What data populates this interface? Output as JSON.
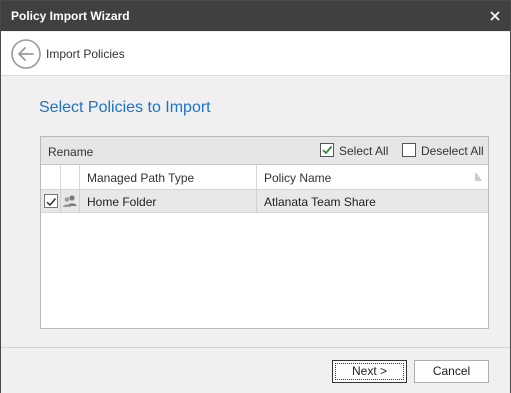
{
  "window": {
    "title": "Policy Import Wizard",
    "close_icon": "close-icon"
  },
  "nav": {
    "back_icon": "back-arrow-icon",
    "title": "Import Policies"
  },
  "heading": "Select Policies to Import",
  "grid": {
    "toolbar": {
      "rename_label": "Rename",
      "select_all_label": "Select All",
      "select_all_checked": true,
      "deselect_all_label": "Deselect All",
      "deselect_all_checked": false
    },
    "columns": [
      "Managed Path Type",
      "Policy Name"
    ],
    "rows": [
      {
        "checked": true,
        "icon": "users-icon",
        "managed_path_type": "Home Folder",
        "policy_name": "Atlanata Team Share"
      }
    ]
  },
  "footer": {
    "next_label": "Next >",
    "cancel_label": "Cancel"
  },
  "colors": {
    "title_bar": "#404040",
    "heading": "#1a73c8",
    "check_green": "#2e8b3a",
    "selected_row": "#e8e8e8"
  }
}
